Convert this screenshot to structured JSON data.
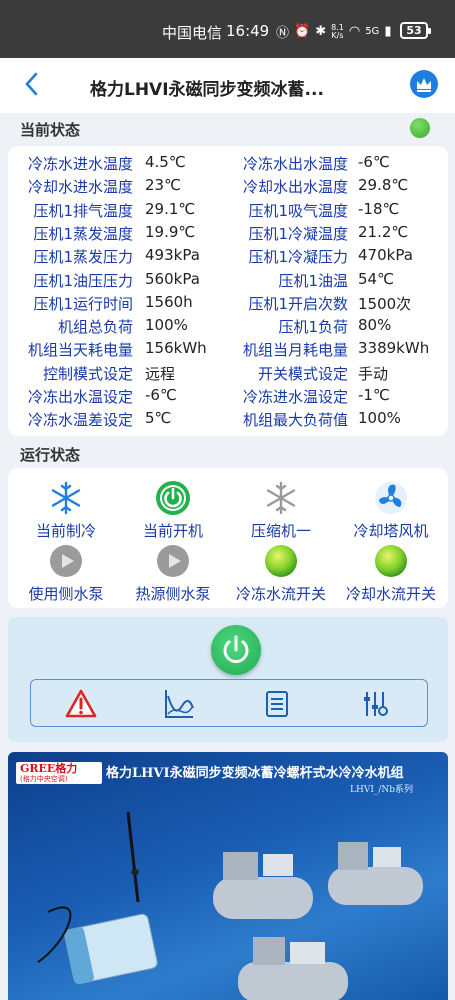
{
  "statusbar": {
    "carrier": "中国电信",
    "time": "16:49",
    "netspeed_value": "8.1",
    "netspeed_unit": "K/s",
    "signal": "5G",
    "battery": "53"
  },
  "header": {
    "title": "格力LHVI永磁同步变频冰蓄..."
  },
  "current_status": {
    "heading": "当前状态",
    "rows": [
      {
        "l1": "冷冻水进水温度",
        "v1": "4.5℃",
        "l2": "冷冻水出水温度",
        "v2": "-6℃"
      },
      {
        "l1": "冷却水进水温度",
        "v1": "23℃",
        "l2": "冷却水出水温度",
        "v2": "29.8℃"
      },
      {
        "l1": "压机1排气温度",
        "v1": "29.1℃",
        "l2": "压机1吸气温度",
        "v2": "-18℃"
      },
      {
        "l1": "压机1蒸发温度",
        "v1": "19.9℃",
        "l2": "压机1冷凝温度",
        "v2": "21.2℃"
      },
      {
        "l1": "压机1蒸发压力",
        "v1": "493kPa",
        "l2": "压机1冷凝压力",
        "v2": "470kPa"
      },
      {
        "l1": "压机1油压压力",
        "v1": "560kPa",
        "l2": "压机1油温",
        "v2": "54℃"
      },
      {
        "l1": "压机1运行时间",
        "v1": "1560h",
        "l2": "压机1开启次数",
        "v2": "1500次"
      },
      {
        "l1": "机组总负荷",
        "v1": "100%",
        "l2": "压机1负荷",
        "v2": "80%"
      },
      {
        "l1": "机组当天耗电量",
        "v1": "156kWh",
        "l2": "机组当月耗电量",
        "v2": "3389kWh"
      },
      {
        "l1": "控制模式设定",
        "v1": "远程",
        "l2": "开关模式设定",
        "v2": "手动"
      },
      {
        "l1": "冷冻出水温设定",
        "v1": "-6℃",
        "l2": "冷冻进水温设定",
        "v2": "-1℃"
      },
      {
        "l1": "冷冻水温差设定",
        "v1": "5℃",
        "l2": "机组最大负荷值",
        "v2": "100%"
      }
    ]
  },
  "run_status": {
    "heading": "运行状态",
    "items": [
      {
        "label": "当前制冷",
        "icon": "snowflake-icon"
      },
      {
        "label": "当前开机",
        "icon": "power-icon"
      },
      {
        "label": "压缩机一",
        "icon": "snowflake-gray-icon"
      },
      {
        "label": "冷却塔风机",
        "icon": "fan-icon"
      },
      {
        "label": "使用侧水泵",
        "icon": "pump-icon"
      },
      {
        "label": "热源侧水泵",
        "icon": "pump-icon"
      },
      {
        "label": "冷冻水流开关",
        "icon": "flow-switch-icon"
      },
      {
        "label": "冷却水流开关",
        "icon": "flow-switch-icon"
      }
    ]
  },
  "banner": {
    "logo_main": "GREE格力",
    "logo_sub": "(格力中央空调)",
    "title": "格力LHVI永磁同步变频冰蓄冷螺杆式水冷冷水机组",
    "subtitle": "LHVI_/Nb系列"
  },
  "colors": {
    "accent": "#1f7fe0",
    "label_blue": "#1a3aa8",
    "on_green": "#2fb55a"
  }
}
